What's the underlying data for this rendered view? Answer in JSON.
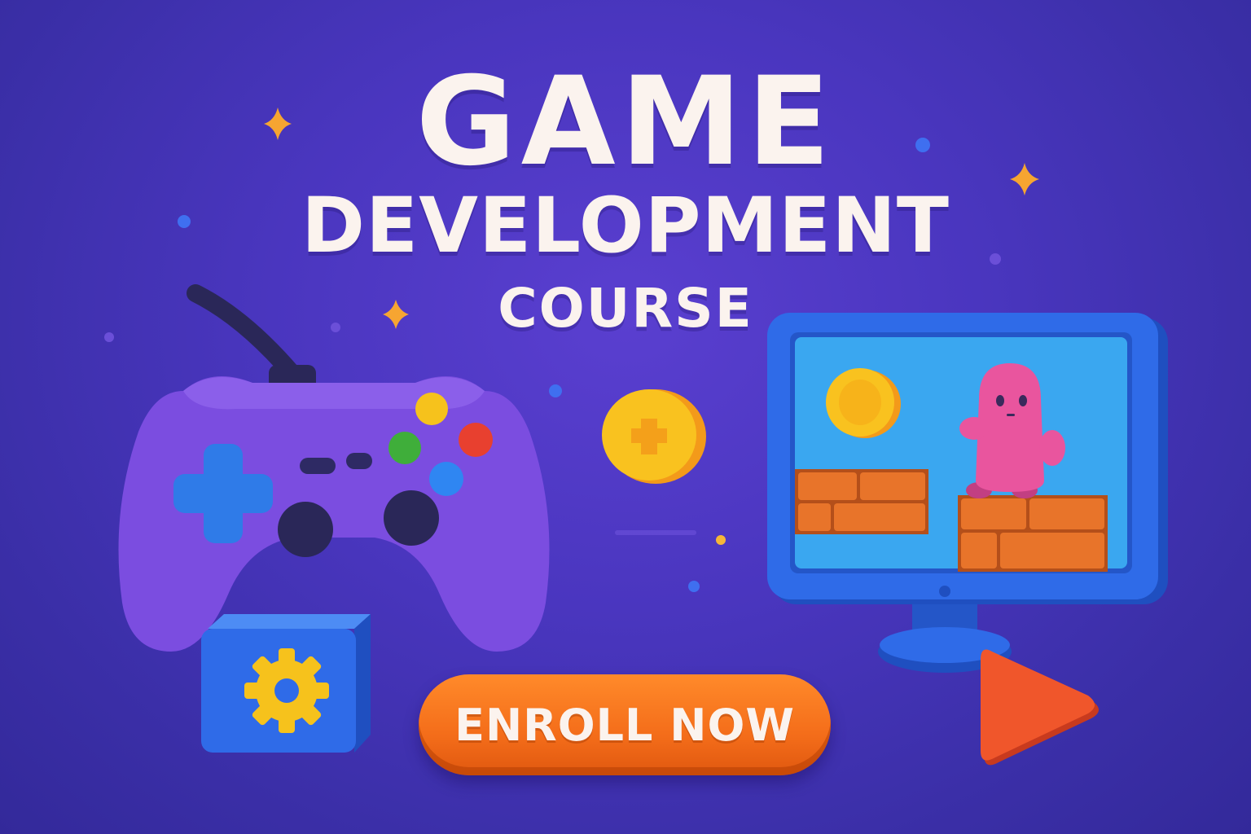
{
  "banner": {
    "title": "GAME",
    "subtitle": "DEVELOPMENT",
    "tagline": "COURSE",
    "cta_label": "ENROLL NOW"
  },
  "icons": [
    "gamepad-icon",
    "coin-icon",
    "monitor-icon",
    "pink-character-icon",
    "brick-platform-icon",
    "settings-cube-icon",
    "gear-icon",
    "play-icon",
    "sparkle-icon"
  ],
  "colors": {
    "background": "#4a36bf",
    "title_text": "#fbf3ee",
    "cta": "#f46d1a",
    "gamepad": "#7b4de0",
    "monitor": "#2f6be0",
    "screen": "#3aa7f0",
    "coin": "#f9c21f",
    "brick": "#e8742a",
    "character": "#e9559e",
    "play": "#f0562b"
  }
}
